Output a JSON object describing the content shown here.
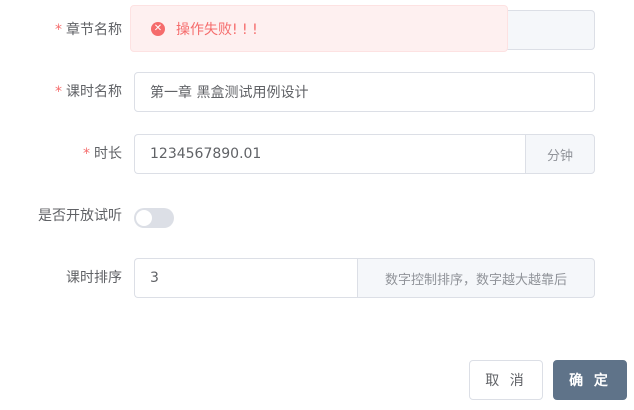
{
  "toast": {
    "icon": "error-circle-icon",
    "message": "操作失败! ! !"
  },
  "form": {
    "chapter_name": {
      "label": "章节名称",
      "required": "*",
      "value": ""
    },
    "lesson_name": {
      "label": "课时名称",
      "required": "*",
      "value": "第一章 黑盒测试用例设计"
    },
    "duration": {
      "label": "时长",
      "required": "*",
      "value": "1234567890.01",
      "unit": "分钟"
    },
    "trial": {
      "label": "是否开放试听",
      "on": false
    },
    "sort": {
      "label": "课时排序",
      "value": "3",
      "hint": "数字控制排序，数字越大越靠后"
    }
  },
  "buttons": {
    "cancel": "取 消",
    "ok": "确 定"
  },
  "colors": {
    "primary": "#5f7389",
    "danger": "#f56c6c",
    "border": "#dcdfe6"
  }
}
